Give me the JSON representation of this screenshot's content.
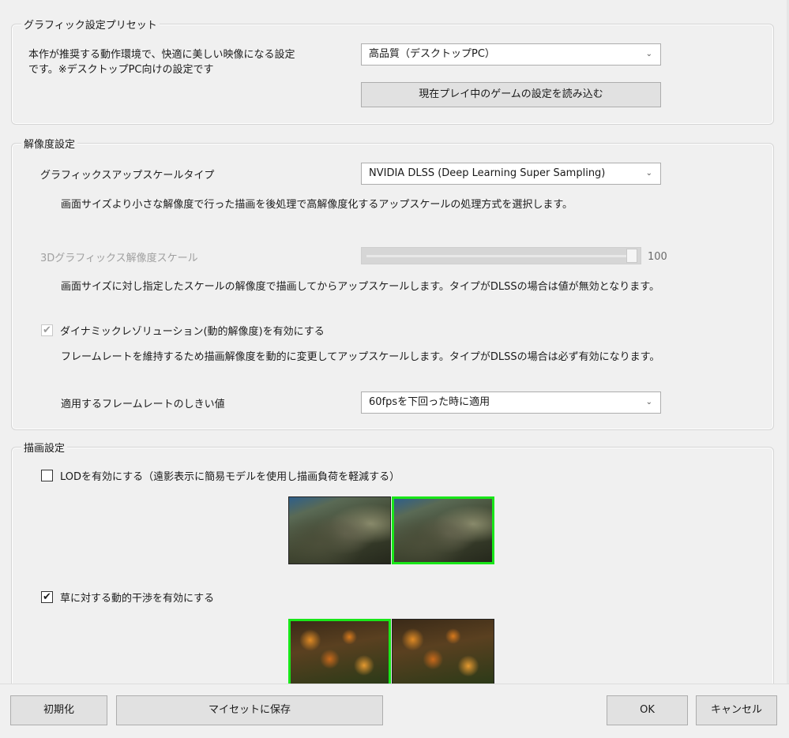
{
  "preset": {
    "legend": "グラフィック設定プリセット",
    "description_line1": "本作が推奨する動作環境で、快適に美しい映像になる設定",
    "description_line2": "です。※デスクトップPC向けの設定です",
    "select_value": "高品質（デスクトップPC）",
    "load_button": "現在プレイ中のゲームの設定を読み込む"
  },
  "resolution": {
    "legend": "解像度設定",
    "upscale_label": "グラフィックスアップスケールタイプ",
    "upscale_value": "NVIDIA DLSS (Deep Learning Super Sampling)",
    "upscale_desc": "画面サイズより小さな解像度で行った描画を後処理で高解像度化するアップスケールの処理方式を選択します。",
    "scale_label": "3Dグラフィックス解像度スケール",
    "scale_value": "100",
    "scale_level": 100,
    "scale_desc": "画面サイズに対し指定したスケールの解像度で描画してからアップスケールします。タイプがDLSSの場合は値が無効となります。",
    "dynamic_label": "ダイナミックレゾリューション(動的解像度)を有効にする",
    "dynamic_checked": true,
    "dynamic_desc": "フレームレートを維持するため描画解像度を動的に変更してアップスケールします。タイプがDLSSの場合は必ず有効になります。",
    "threshold_label": "適用するフレームレートのしきい値",
    "threshold_value": "60fpsを下回った時に適用"
  },
  "render": {
    "legend": "描画設定",
    "lod_label": "LODを有効にする（遠影表示に簡易モデルを使用し描画負荷を軽減する）",
    "lod_checked": false,
    "grass_label": "草に対する動的干渉を有効にする",
    "grass_checked": true
  },
  "footer": {
    "reset_button": "初期化",
    "save_preset_button": "マイセットに保存",
    "ok_button": "OK",
    "cancel_button": "キャンセル"
  },
  "icons": {
    "dropdown": "chevron-down-icon",
    "check": "checkmark-icon"
  },
  "colors": {
    "selected_border": "#19e619",
    "background": "#f0f0f0"
  }
}
